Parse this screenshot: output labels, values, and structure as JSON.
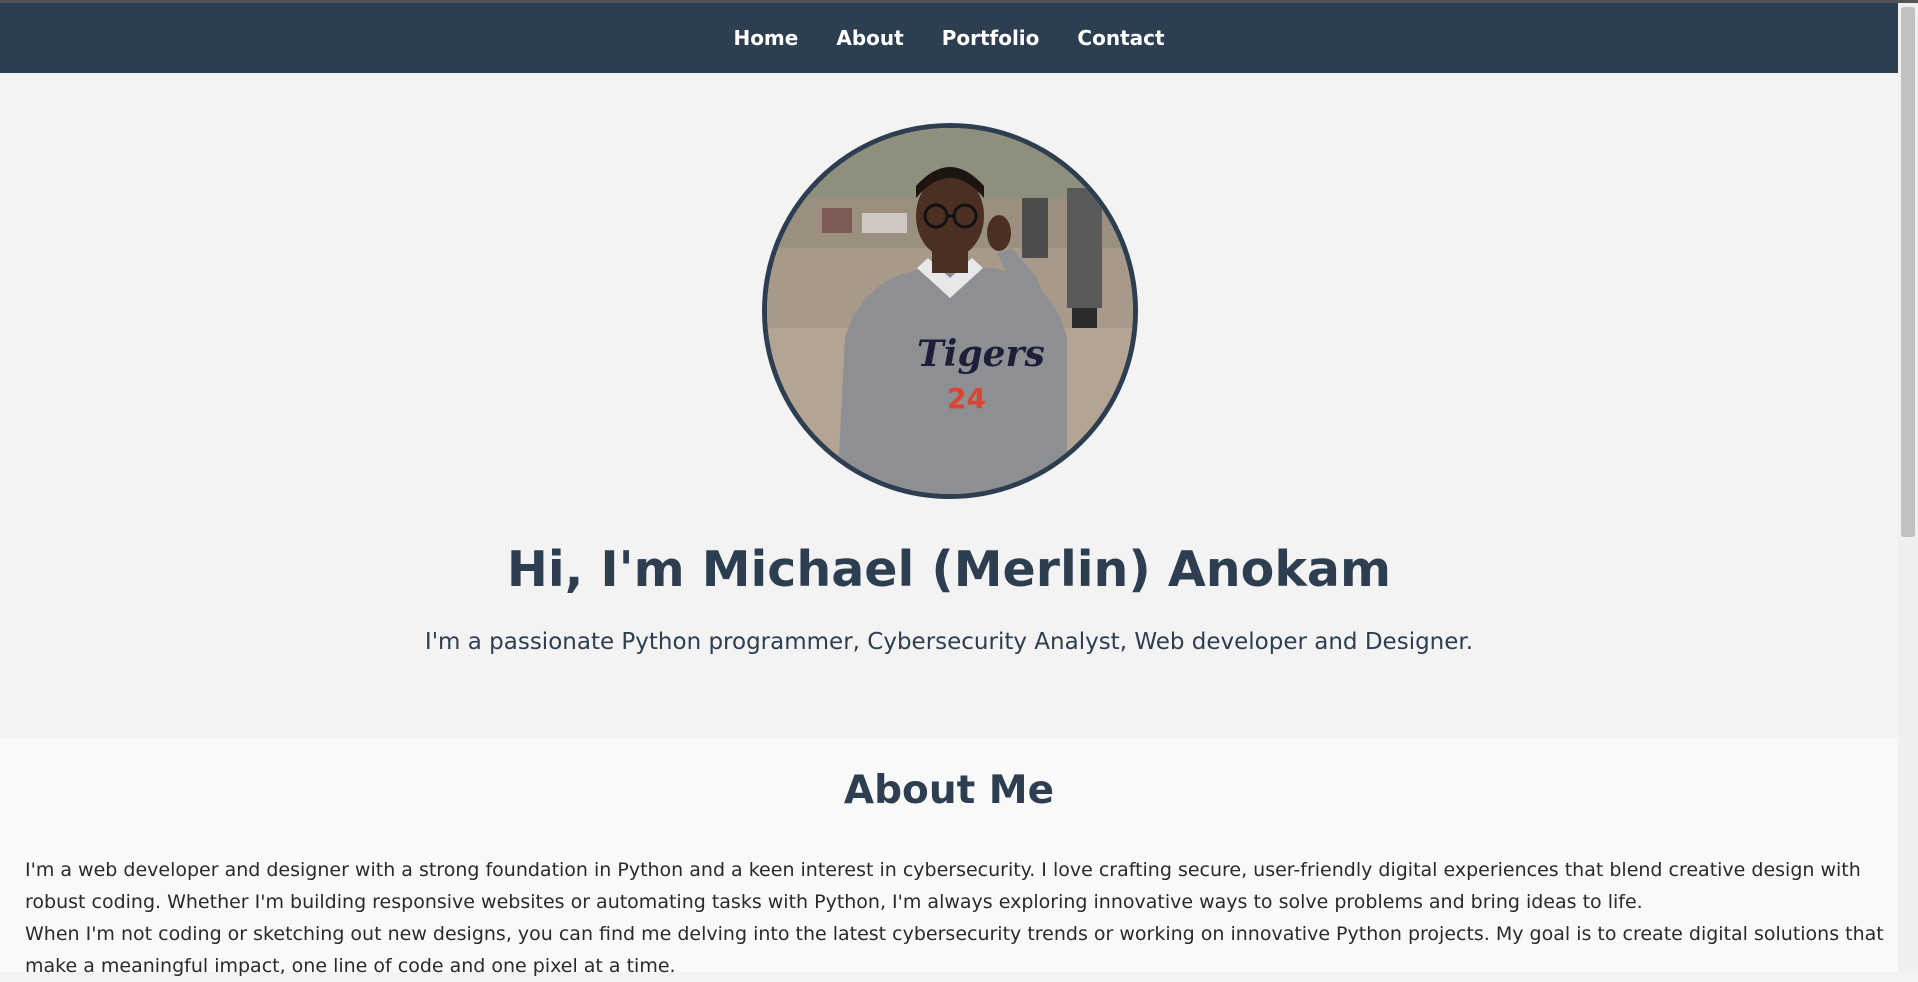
{
  "nav": {
    "items": [
      {
        "label": "Home"
      },
      {
        "label": "About"
      },
      {
        "label": "Portfolio"
      },
      {
        "label": "Contact"
      }
    ]
  },
  "hero": {
    "photo_icon": "profile-photo",
    "title": "Hi, I'm Michael (Merlin) Anokam",
    "subtitle": "I'm a passionate Python programmer, Cybersecurity Analyst, Web developer and Designer."
  },
  "about": {
    "title": "About Me",
    "paragraph_1": "I'm a web developer and designer with a strong foundation in Python and a keen interest in cybersecurity. I love crafting secure, user-friendly digital experiences that blend creative design with robust coding. Whether I'm building responsive websites or automating tasks with Python, I'm always exploring innovative ways to solve problems and bring ideas to life.",
    "paragraph_2": "When I'm not coding or sketching out new designs, you can find me delving into the latest cybersecurity trends or working on innovative Python projects. My goal is to create digital solutions that make a meaningful impact, one line of code and one pixel at a time."
  },
  "colors": {
    "primary": "#2c3e50",
    "background": "#f3f3f3",
    "section_background": "#f9f9f9",
    "nav_text": "#ffffff"
  }
}
